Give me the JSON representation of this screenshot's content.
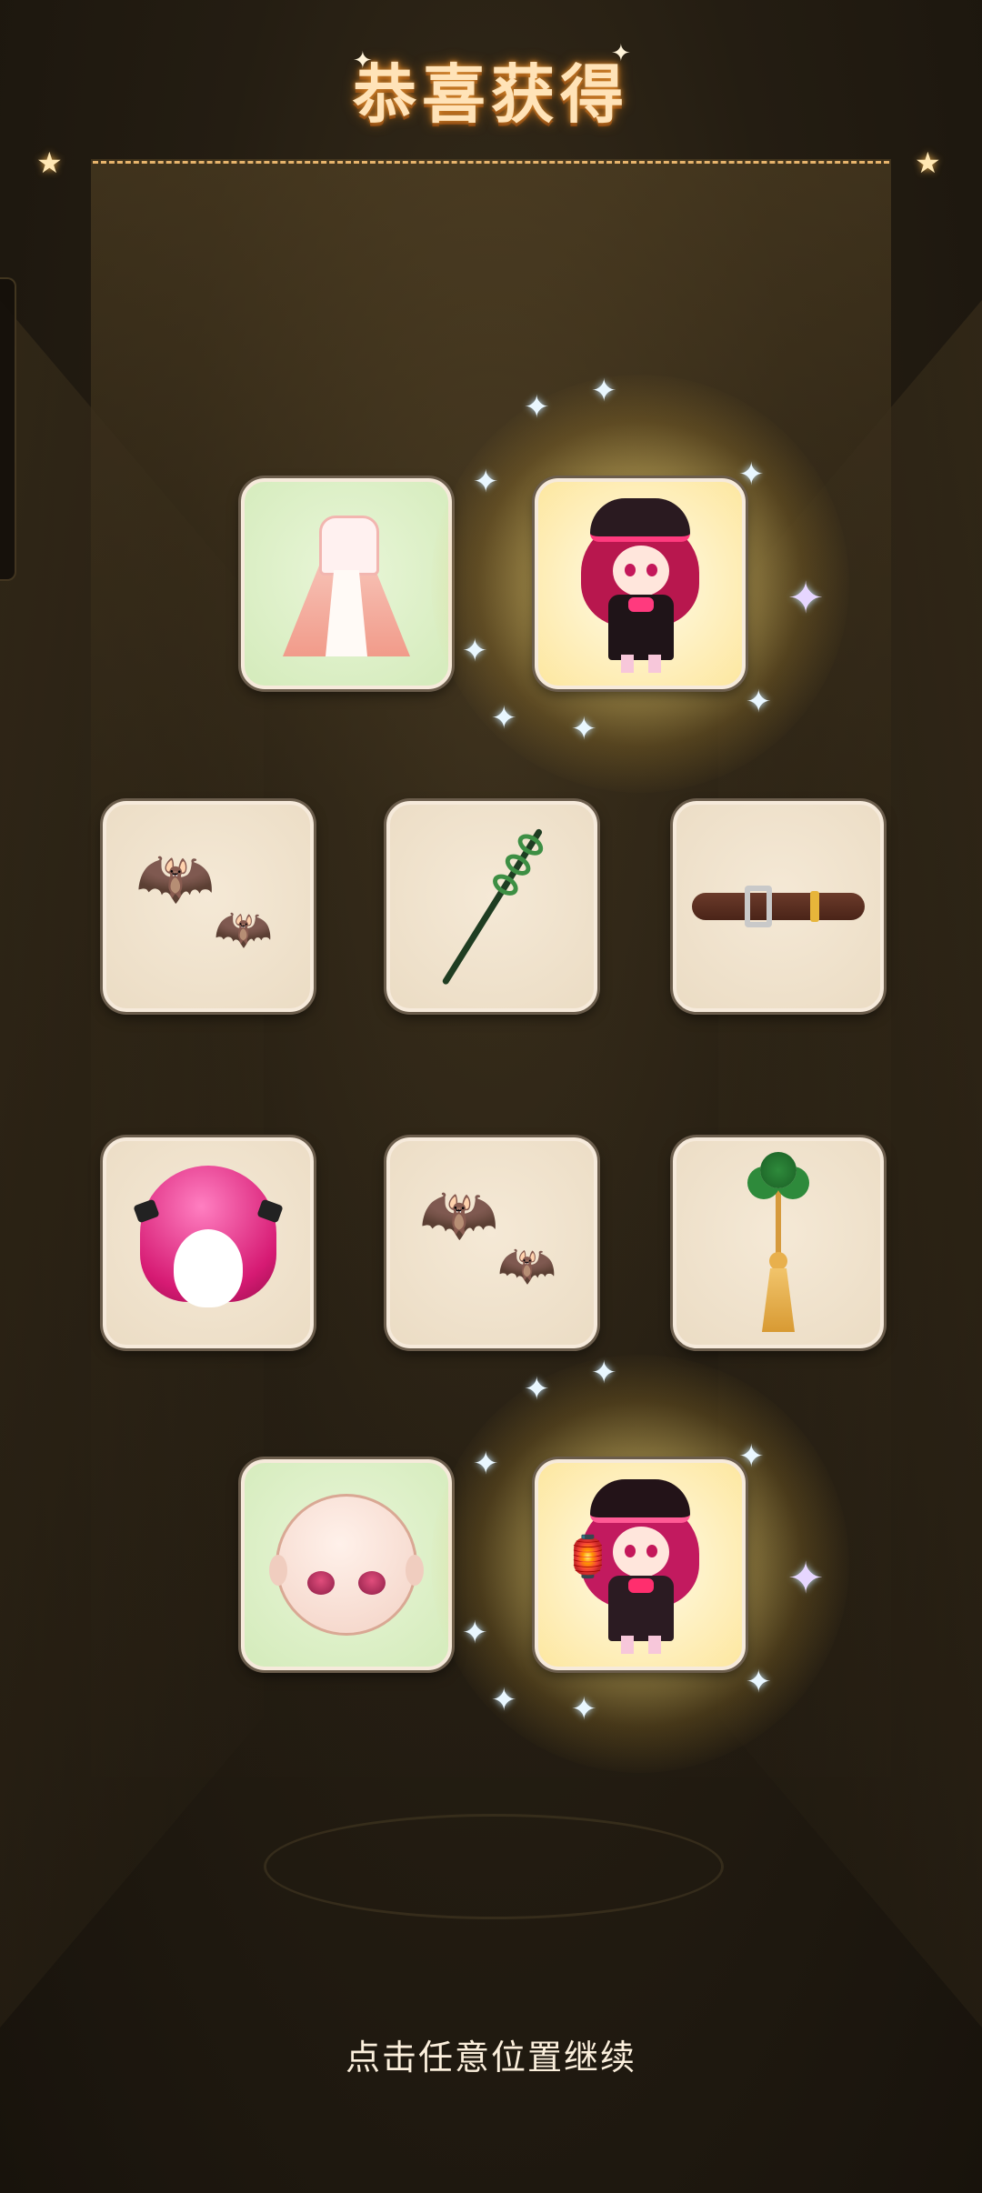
{
  "header": {
    "title": "恭喜获得"
  },
  "rewards": [
    {
      "id": "dress",
      "icon": "pink-dress-outfit-icon",
      "frame": "green"
    },
    {
      "id": "character-card-1",
      "icon": "gothic-lolita-character-icon",
      "frame": "gold",
      "highlighted": true
    },
    {
      "id": "bats-1",
      "icon": "bats-accessory-icon",
      "frame": "beige"
    },
    {
      "id": "snake-staff",
      "icon": "snake-staff-icon",
      "frame": "beige"
    },
    {
      "id": "belt",
      "icon": "leather-belt-icon",
      "frame": "beige"
    },
    {
      "id": "wig",
      "icon": "pink-wig-icon",
      "frame": "beige"
    },
    {
      "id": "bats-2",
      "icon": "bats-accessory-icon",
      "frame": "beige"
    },
    {
      "id": "tassel",
      "icon": "clover-tassel-icon",
      "frame": "beige"
    },
    {
      "id": "face",
      "icon": "face-makeup-icon",
      "frame": "green"
    },
    {
      "id": "character-card-2",
      "icon": "lantern-character-icon",
      "frame": "gold",
      "highlighted": true
    }
  ],
  "footer": {
    "continue_text": "点击任意位置继续"
  },
  "colors": {
    "title_glow": "#d9892e",
    "frame_border": "#f6eadb",
    "beige_frame_bg": "#ebdcc4",
    "green_frame_bg": "#d4ebbb",
    "highlight_glow": "#ffe178"
  }
}
